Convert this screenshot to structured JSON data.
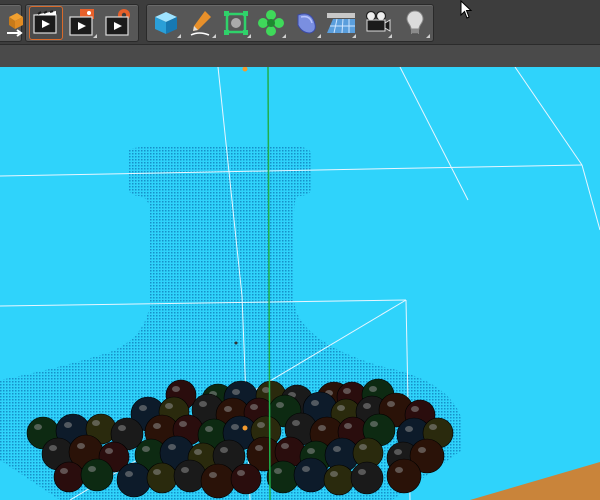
{
  "colors": {
    "toolbar_bg": "#3d3d3d",
    "viewport_bg": "#2fd3fb",
    "active_outline": "#d96a2a",
    "y_axis": "#1fb04a",
    "wire": "#e8f6ff",
    "floor": "#c9843a"
  },
  "toolbar": {
    "groups": [
      {
        "name": "edit-tools",
        "buttons": [
          {
            "icon": "render-region-icon"
          }
        ]
      },
      {
        "name": "render-tools",
        "buttons": [
          {
            "icon": "render-view-icon",
            "active": true
          },
          {
            "icon": "render-picture-viewer-icon"
          },
          {
            "icon": "render-settings-icon"
          }
        ]
      },
      {
        "name": "object-tools",
        "buttons": [
          {
            "icon": "cube-primitive-icon"
          },
          {
            "icon": "pen-spline-icon"
          },
          {
            "icon": "subdivision-surface-icon"
          },
          {
            "icon": "cloner-icon"
          },
          {
            "icon": "deformer-icon"
          },
          {
            "icon": "floor-plane-icon"
          },
          {
            "icon": "camera-icon"
          },
          {
            "icon": "light-bulb-icon"
          }
        ]
      }
    ]
  }
}
